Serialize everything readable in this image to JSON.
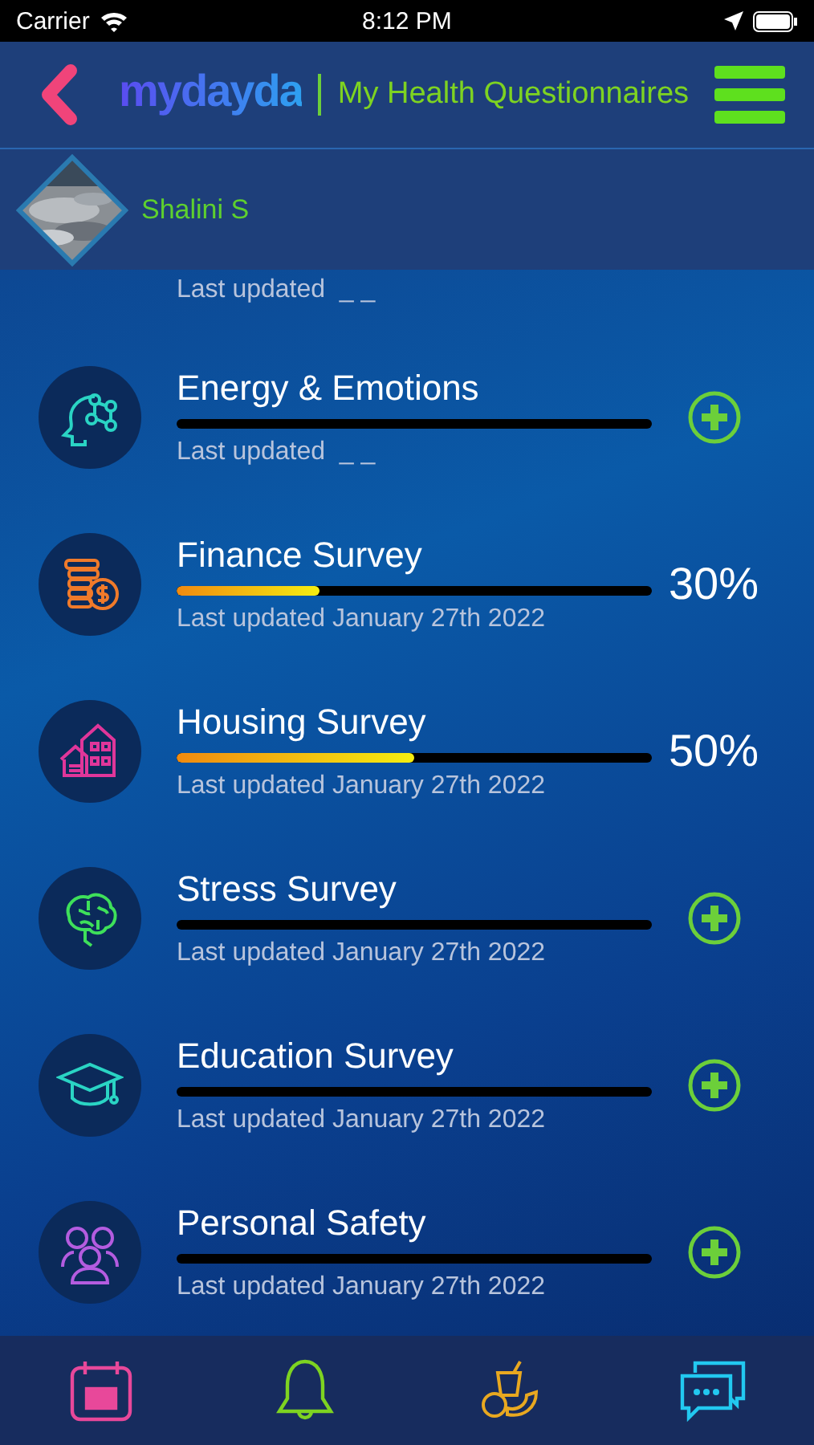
{
  "status_bar": {
    "carrier": "Carrier",
    "time": "8:12 PM"
  },
  "header": {
    "logo": "mydayda",
    "title": "My Health Questionnaires"
  },
  "profile": {
    "name": "Shalini S"
  },
  "partial_row": {
    "last_updated": "Last updated  _ _"
  },
  "surveys": [
    {
      "title": "Energy & Emotions",
      "color": "#2ad4c4",
      "level": 0,
      "last_updated": "Last updated  _ _",
      "kind": "new"
    },
    {
      "title": "Finance Survey",
      "color": "#f07a2a",
      "level": 0.3,
      "last_updated": "Last updated January 27th 2022",
      "kind": "progress",
      "percent": "30%"
    },
    {
      "title": "Housing Survey",
      "color": "#e0369a",
      "level": 0.5,
      "last_updated": "Last updated January 27th 2022",
      "kind": "progress",
      "percent": "50%"
    },
    {
      "title": "Stress Survey",
      "color": "#3ee05a",
      "level": 0,
      "last_updated": "Last updated January 27th 2022",
      "kind": "new"
    },
    {
      "title": "Education Survey",
      "color": "#2ad4c4",
      "level": 0,
      "last_updated": "Last updated January 27th 2022",
      "kind": "new"
    },
    {
      "title": "Personal Safety",
      "color": "#b45ce0",
      "level": 0,
      "last_updated": "Last updated January 27th 2022",
      "kind": "new"
    }
  ]
}
